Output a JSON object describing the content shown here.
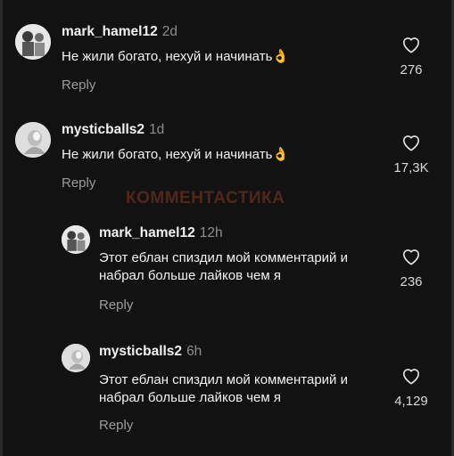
{
  "watermark": "КОММЕНТАСТИКА",
  "comments": [
    {
      "username": "mark_hamel12",
      "time": "2d",
      "text": "Не жили богато, нехуй и начинать👌",
      "reply": "Reply",
      "likes": "276"
    },
    {
      "username": "mysticballs2",
      "time": "1d",
      "text": "Не жили богато, нехуй и начинать👌",
      "reply": "Reply",
      "likes": "17,3K"
    },
    {
      "username": "mark_hamel12",
      "time": "12h",
      "text": "Этот еблан спиздил мой комментарий и набрал больше лайков чем я",
      "reply": "Reply",
      "likes": "236"
    },
    {
      "username": "mysticballs2",
      "time": "6h",
      "text": "Этот еблан спиздил мой комментарий и набрал больше лайков чем я",
      "reply": "Reply",
      "likes": "4,129"
    }
  ],
  "icons": {
    "like": "heart-outline-icon"
  }
}
